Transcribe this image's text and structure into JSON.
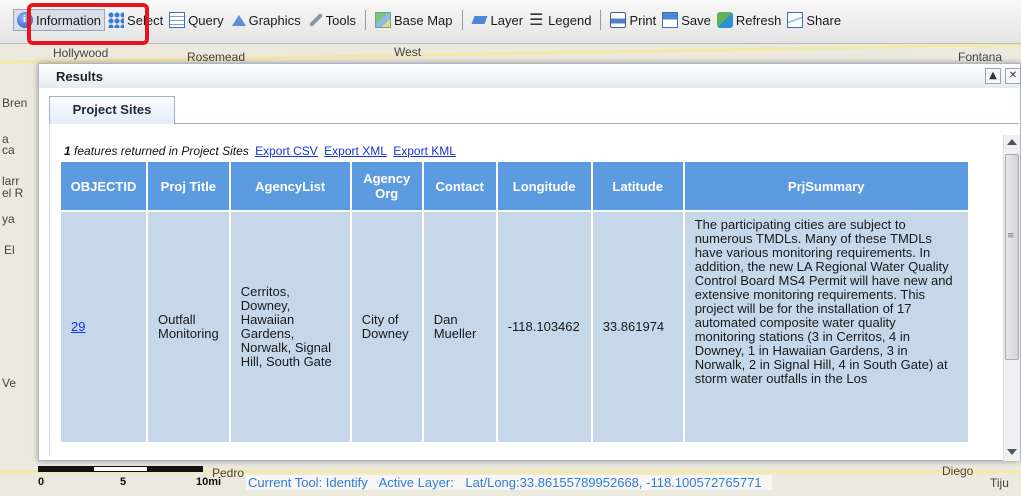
{
  "toolbar": {
    "items": [
      {
        "label": "Information",
        "icon": "info-icon"
      },
      {
        "label": "Select",
        "icon": "select-icon"
      },
      {
        "label": "Query",
        "icon": "query-icon"
      },
      {
        "label": "Graphics",
        "icon": "graphics-icon"
      },
      {
        "label": "Tools",
        "icon": "tools-icon"
      },
      {
        "label": "Base Map",
        "icon": "basemap-icon"
      },
      {
        "label": "Layer",
        "icon": "layer-icon"
      },
      {
        "label": "Legend",
        "icon": "legend-icon"
      },
      {
        "label": "Print",
        "icon": "print-icon"
      },
      {
        "label": "Save",
        "icon": "save-icon"
      },
      {
        "label": "Refresh",
        "icon": "refresh-icon"
      },
      {
        "label": "Share",
        "icon": "share-icon"
      }
    ],
    "highlight_color": "#e8141b"
  },
  "map": {
    "places": [
      "Hollywood",
      "Rosemead",
      "West",
      "Fontana",
      "Bren",
      "a",
      "ca",
      "larr",
      "el R",
      "ya",
      "El",
      "Ve",
      "Diego",
      "Pedro",
      "Tiju"
    ]
  },
  "panel": {
    "title": "Results",
    "collapse_glyph": "▲",
    "close_glyph": "✕",
    "tab_label": "Project Sites",
    "summary": {
      "count": "1",
      "text": " features returned in Project Sites",
      "links": [
        "Export CSV",
        "Export XML",
        "Export KML"
      ]
    },
    "table": {
      "headers": [
        "OBJECTID",
        "Proj Title",
        "AgencyList",
        "Agency Org",
        "Contact",
        "Longitude",
        "Latitude",
        "PrjSummary"
      ],
      "row": {
        "objectid": "29",
        "proj_title": "Outfall Monitoring",
        "agency_list": "Cerritos, Downey, Hawaiian Gardens, Norwalk, Signal Hill, South Gate",
        "agency_org": "City of Downey",
        "contact": "Dan Mueller",
        "longitude": "-118.103462",
        "latitude": "33.861974",
        "summary": "The participating cities are subject to numerous TMDLs. Many of these TMDLs have various monitoring requirements. In addition, the new LA Regional Water Quality Control Board MS4 Permit will have new and extensive monitoring requirements. This project will be for the installation of 17 automated composite water quality monitoring stations (3 in Cerritos, 4 in Downey, 1 in Hawaiian Gardens, 3 in Norwalk, 2 in Signal Hill, 4 in South Gate) at storm water outfalls in the Los"
      }
    },
    "header_color": "#5c9be0",
    "cell_color": "#c6d7ea"
  },
  "status": {
    "scale_labels": [
      "0",
      "5",
      "10mi"
    ],
    "current_tool": "Current Tool: Identify",
    "active_layer": "Active Layer:",
    "latlong": "Lat/Long:33.86155789952668, -118.100572765771"
  }
}
